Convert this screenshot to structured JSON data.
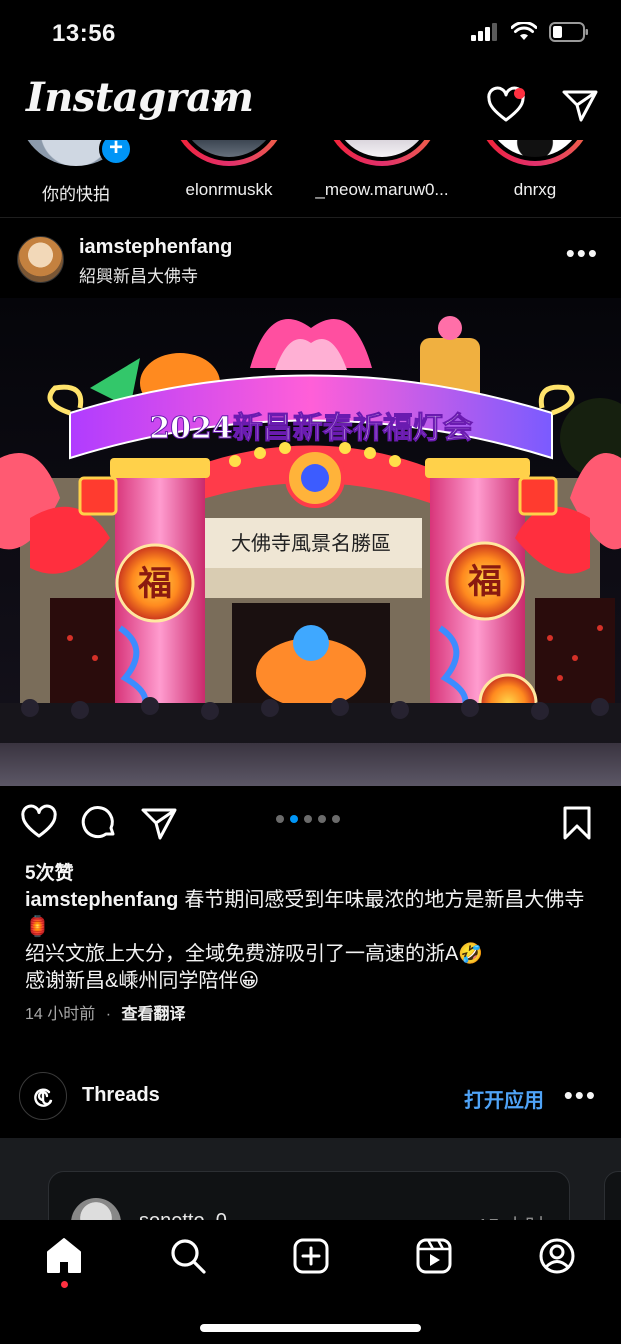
{
  "status_bar": {
    "time": "13:56"
  },
  "app_bar": {
    "logo": "Instagram"
  },
  "stories": [
    {
      "label": "你的快拍",
      "ring": "none"
    },
    {
      "label": "elonrmuskk",
      "ring": "gradient"
    },
    {
      "label": "_meow.maruw0...",
      "ring": "gradient"
    },
    {
      "label": "dnrxg",
      "ring": "gradient"
    }
  ],
  "post": {
    "username": "iamstephenfang",
    "location": "紹興新昌大佛寺",
    "photo": {
      "arch_text": "2024新昌新春祈福灯会",
      "gate_plaque": "大佛寺風景名勝區",
      "pillar_char": "福"
    },
    "carousel": {
      "count": 5,
      "active": 1
    },
    "likes": "5次赞",
    "caption_user": "iamstephenfang",
    "caption_text": "春节期间感受到年味最浓的地方是新昌大佛寺🏮\n绍兴文旅上大分，全域免费游吸引了一高速的浙A🤣\n感谢新昌&嵊州同学陪伴😀",
    "time": "14 小时前",
    "separator": "·",
    "translate": "查看翻译"
  },
  "threads": {
    "name": "Threads",
    "open_label": "打开应用",
    "card": {
      "user": "sonetto_0",
      "time": "15 小时"
    }
  },
  "colors": {
    "accent_blue": "#0095f6",
    "notification_red": "#ff3040",
    "link_blue": "#4fa3f7"
  },
  "icons": {
    "status": [
      "cellular-signal-icon",
      "wifi-icon",
      "battery-icon"
    ],
    "app_bar": [
      "chevron-down-icon",
      "heart-icon",
      "direct-message-icon"
    ],
    "actions": [
      "like-icon",
      "comment-icon",
      "share-icon",
      "bookmark-icon"
    ],
    "nav": [
      "home-icon",
      "search-icon",
      "create-icon",
      "reels-icon",
      "profile-icon"
    ]
  }
}
